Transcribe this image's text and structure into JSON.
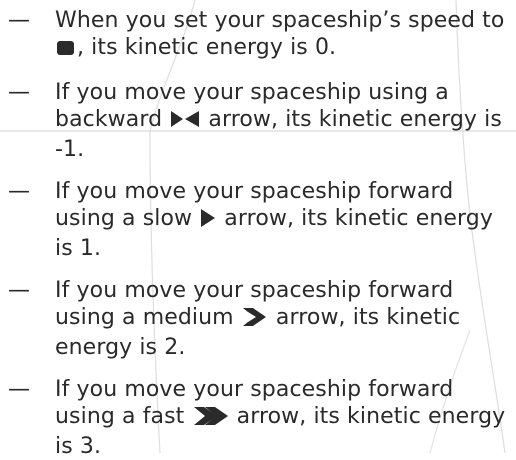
{
  "rules": [
    {
      "before": "When you set your spaceship’s speed to ",
      "icon": "stop-square-icon",
      "after": ", its kinetic energy is 0."
    },
    {
      "before": "If you move your spaceship using a backward ",
      "icon": "backward-arrow-icon",
      "after": " arrow, its kinetic energy is -1."
    },
    {
      "before": "If you move your spaceship forward using a slow ",
      "icon": "slow-arrow-icon",
      "after": " arrow, its kinetic energy is 1."
    },
    {
      "before": "If you move your spaceship forward using a medium ",
      "icon": "medium-arrow-icon",
      "after": " arrow, its kinetic energy is 2."
    },
    {
      "before": "If you move your spaceship forward using a fast ",
      "icon": "fast-arrow-icon",
      "after": " arrow, its kinetic energy is 3."
    }
  ],
  "bullet_symbol": "—",
  "colors": {
    "text": "#2a2a2a",
    "background_lines": "#d9d9d9"
  }
}
